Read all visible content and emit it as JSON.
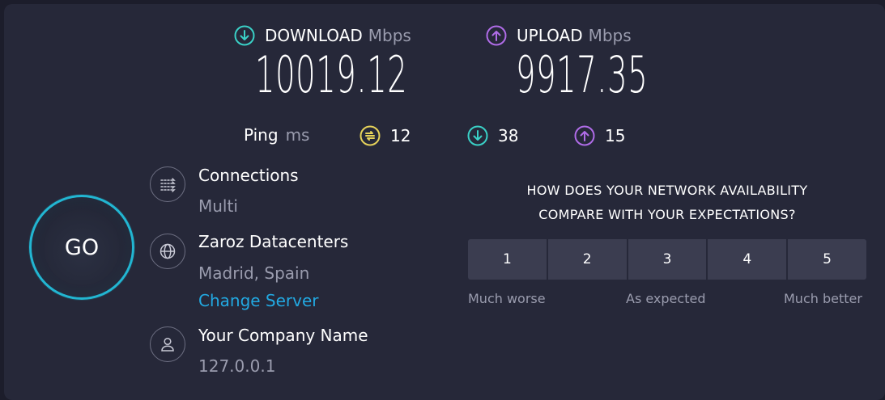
{
  "download": {
    "label": "DOWNLOAD",
    "unit": "Mbps",
    "value": "10019.12",
    "icon": "download-arrow-icon",
    "color": "#3ad1c7"
  },
  "upload": {
    "label": "UPLOAD",
    "unit": "Mbps",
    "value": "9917.35",
    "icon": "upload-arrow-icon",
    "color": "#b06ce8"
  },
  "ping": {
    "label": "Ping",
    "unit": "ms",
    "idle": {
      "value": "12",
      "icon": "jitter-icon",
      "color": "#e6d25a"
    },
    "download": {
      "value": "38",
      "icon": "download-arrow-icon",
      "color": "#3ad1c7"
    },
    "upload": {
      "value": "15",
      "icon": "upload-arrow-icon",
      "color": "#b06ce8"
    }
  },
  "go_button": {
    "label": "GO",
    "color": "#22b6d2"
  },
  "connections": {
    "title": "Connections",
    "value": "Multi",
    "icon": "connections-icon"
  },
  "server": {
    "title": "Zaroz Datacenters",
    "location": "Madrid, Spain",
    "change_label": "Change Server",
    "icon": "globe-icon"
  },
  "provider": {
    "title": "Your Company Name",
    "ip": "127.0.0.1",
    "icon": "user-icon"
  },
  "survey": {
    "question_line1": "HOW DOES YOUR NETWORK AVAILABILITY",
    "question_line2": "COMPARE WITH YOUR EXPECTATIONS?",
    "options": [
      "1",
      "2",
      "3",
      "4",
      "5"
    ],
    "label_low": "Much worse",
    "label_mid": "As expected",
    "label_high": "Much better"
  }
}
